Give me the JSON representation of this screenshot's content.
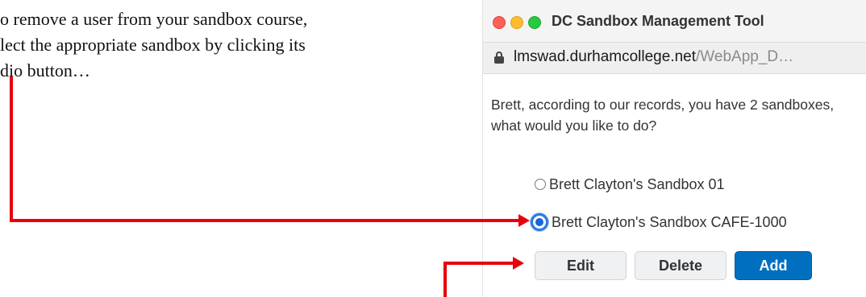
{
  "instruction": {
    "lines": [
      "o remove a user from your sandbox course,",
      "lect the appropriate sandbox by clicking its",
      "dio button…"
    ]
  },
  "window": {
    "title": "DC Sandbox Management Tool",
    "url_host": "lmswad.durhamcollege.net",
    "url_rest": "/WebApp_D…"
  },
  "prompt": "Brett, according to our records, you have 2 sandboxes, what would you like to do?",
  "sandboxes": [
    {
      "label": "Brett Clayton's Sandbox 01",
      "selected": false
    },
    {
      "label": "Brett Clayton's Sandbox CAFE-1000",
      "selected": true
    }
  ],
  "buttons": {
    "edit": "Edit",
    "delete": "Delete",
    "add": "Add"
  },
  "colors": {
    "annotation_arrow": "#e8000b",
    "add_button": "#006fbf",
    "radio_selected": "#1765d8"
  }
}
